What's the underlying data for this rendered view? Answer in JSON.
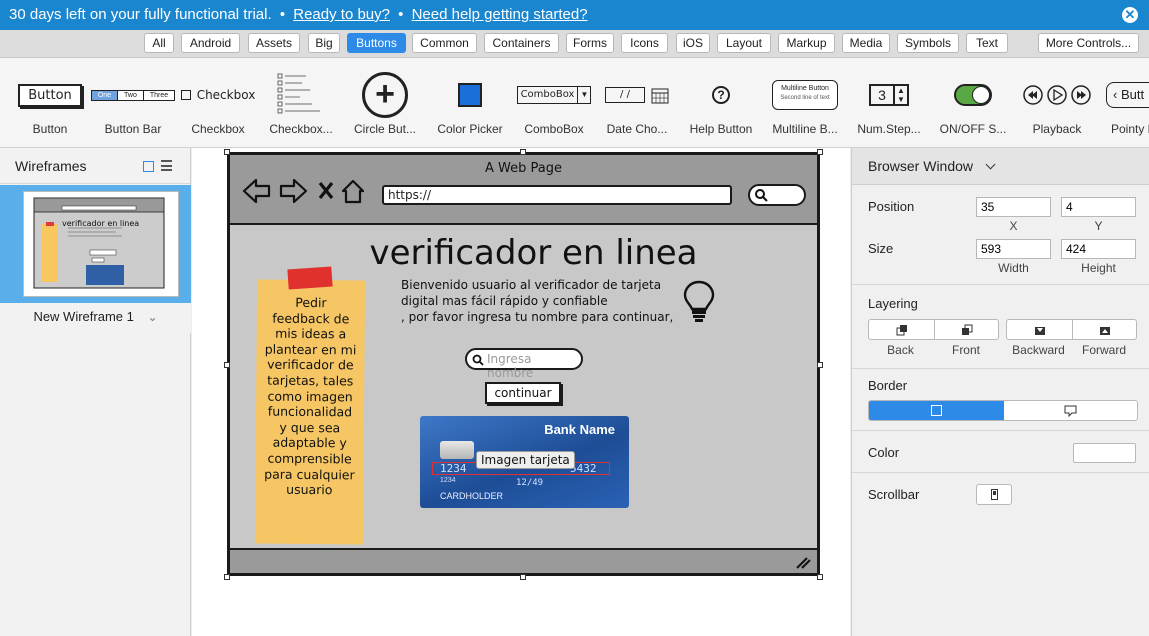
{
  "banner": {
    "trial_text": "30 days left on your fully functional trial.",
    "sep1": "•",
    "buy_link": "Ready to buy?",
    "sep2": "•",
    "help_link": "Need help getting started?",
    "close_glyph": "✕"
  },
  "categories": [
    {
      "label": "All",
      "active": false
    },
    {
      "label": "Android",
      "active": false
    },
    {
      "label": "Assets",
      "active": false
    },
    {
      "label": "Big",
      "active": false
    },
    {
      "label": "Buttons",
      "active": true
    },
    {
      "label": "Common",
      "active": false
    },
    {
      "label": "Containers",
      "active": false
    },
    {
      "label": "Forms",
      "active": false
    },
    {
      "label": "Icons",
      "active": false
    },
    {
      "label": "iOS",
      "active": false
    },
    {
      "label": "Layout",
      "active": false
    },
    {
      "label": "Markup",
      "active": false
    },
    {
      "label": "Media",
      "active": false
    },
    {
      "label": "Symbols",
      "active": false
    },
    {
      "label": "Text",
      "active": false
    },
    {
      "label": "More Controls...",
      "active": false
    }
  ],
  "shelf": {
    "items": [
      {
        "label": "Button",
        "icon": "button-icon",
        "text": "Button"
      },
      {
        "label": "Button Bar",
        "icon": "button-bar-icon",
        "segments": [
          "One",
          "Two",
          "Three"
        ]
      },
      {
        "label": "Checkbox",
        "icon": "checkbox-icon",
        "text": "Checkbox"
      },
      {
        "label": "Checkbox...",
        "icon": "checkbox-group-icon"
      },
      {
        "label": "Circle But...",
        "icon": "circle-button-icon",
        "text": "+"
      },
      {
        "label": "Color Picker",
        "icon": "color-picker-icon"
      },
      {
        "label": "ComboBox",
        "icon": "combobox-icon",
        "text": "ComboBox",
        "arrow": "▼"
      },
      {
        "label": "Date Cho...",
        "icon": "date-chooser-icon",
        "text": "/   /"
      },
      {
        "label": "Help Button",
        "icon": "help-button-icon",
        "text": "?"
      },
      {
        "label": "Multiline B...",
        "icon": "multiline-button-icon",
        "text1": "Multiline Button",
        "text2": "Second line of text"
      },
      {
        "label": "Num.Step...",
        "icon": "numeric-stepper-icon",
        "text": "3"
      },
      {
        "label": "ON/OFF S...",
        "icon": "toggle-switch-icon"
      },
      {
        "label": "Playback",
        "icon": "playback-icon"
      },
      {
        "label": "Pointy B",
        "icon": "pointy-button-icon",
        "text": "Butt"
      }
    ]
  },
  "left_panel": {
    "title": "Wireframes",
    "thumb_title": "verificador en linea",
    "wireframe_name": "New Wireframe 1",
    "chevron": "⌄"
  },
  "mockup": {
    "window_title": "A Web Page",
    "url": "https://",
    "heading": "verificador en linea",
    "intro_lines": [
      "Bienvenido usuario al verificador de tarjeta",
      "digital mas fácil rápido y confiable",
      ", por favor ingresa tu nombre para continuar,"
    ],
    "sticky_note": "Pedir feedback de mis ideas a plantear en mi verificador de tarjetas, tales como imagen funcionalidad y que sea adaptable y comprensible para cualquier usuario",
    "search_placeholder": "Ingresa nombre",
    "continue_label": "continuar",
    "card": {
      "bank_name": "Bank Name",
      "number_left": "1234",
      "number_right": "5432",
      "small_num": "1234",
      "valid_thru": "12/49",
      "holder": "CARDHOLDER",
      "caption": "Imagen tarjeta"
    }
  },
  "right_panel": {
    "title": "Browser Window",
    "position_label": "Position",
    "x_value": "35",
    "y_value": "4",
    "x_label": "X",
    "y_label": "Y",
    "size_label": "Size",
    "width_value": "593",
    "height_value": "424",
    "width_label": "Width",
    "height_label": "Height",
    "layering_label": "Layering",
    "layer_buttons": [
      "Back",
      "Front",
      "Backward",
      "Forward"
    ],
    "border_label": "Border",
    "color_label": "Color",
    "scrollbar_label": "Scrollbar"
  }
}
